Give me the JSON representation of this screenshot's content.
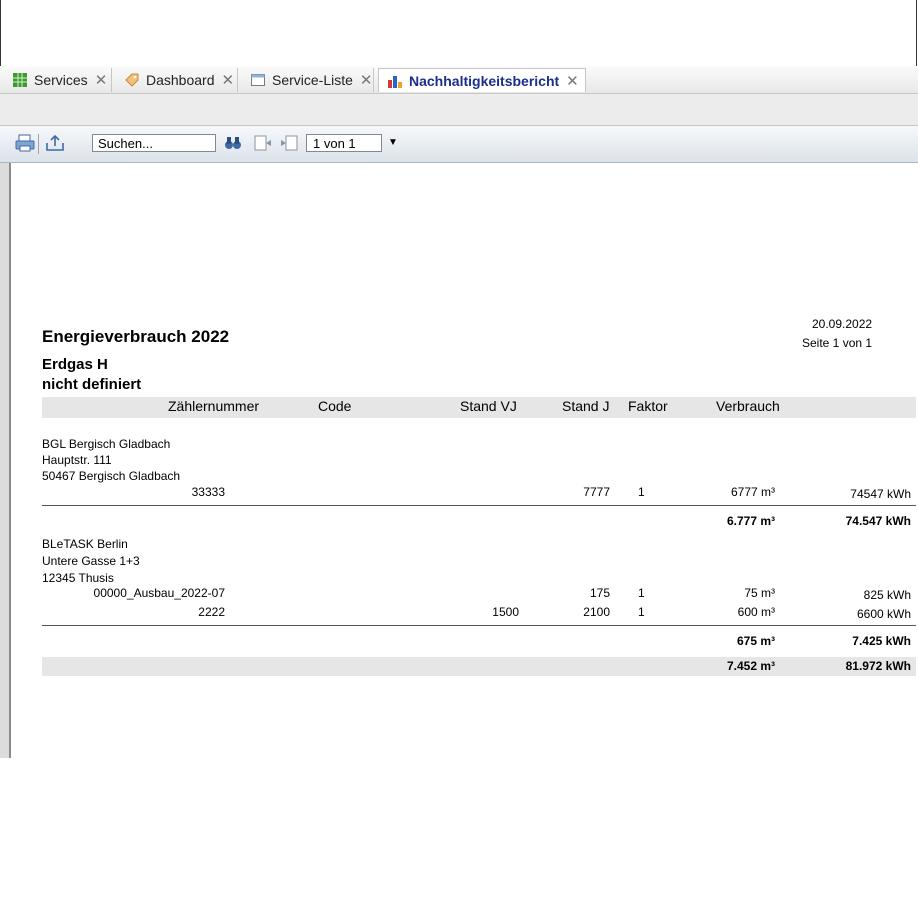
{
  "tabs": [
    {
      "label": "Services",
      "icon": "grid-icon"
    },
    {
      "label": "Dashboard",
      "icon": "tag-icon"
    },
    {
      "label": "Service-Liste",
      "icon": "window-icon"
    },
    {
      "label": "Nachhaltigkeitsbericht",
      "icon": "bar-chart-icon",
      "active": true
    }
  ],
  "toolbar": {
    "search_placeholder": "Suchen...",
    "page_value": "1 von 1"
  },
  "report": {
    "title": "Energieverbrauch 2022",
    "date": "20.09.2022",
    "page": "Seite 1 von 1",
    "fuel": "Erdgas H",
    "category": "nicht definiert",
    "columns": [
      "Zählernummer",
      "Code",
      "Stand VJ",
      "Stand J",
      "Faktor",
      "Verbrauch"
    ],
    "groups": [
      {
        "name": "BGL Bergisch Gladbach",
        "street": "Hauptstr. 111",
        "city": "50467 Bergisch Gladbach",
        "rows": [
          {
            "meter": "33333",
            "code": "",
            "stand_vj": "",
            "stand_j": "7777",
            "faktor": "1",
            "verbrauch": "6777 m³",
            "kwh": "74547 kWh"
          }
        ],
        "subtotal_m3": "6.777 m³",
        "subtotal_kwh": "74.547 kWh"
      },
      {
        "name": "BLeTASK Berlin",
        "street": "Untere Gasse 1+3",
        "city": "12345 Thusis",
        "rows": [
          {
            "meter": "00000_Ausbau_2022-07",
            "code": "",
            "stand_vj": "",
            "stand_j": "175",
            "faktor": "1",
            "verbrauch": "75 m³",
            "kwh": "825 kWh"
          },
          {
            "meter": "2222",
            "code": "",
            "stand_vj": "1500",
            "stand_j": "2100",
            "faktor": "1",
            "verbrauch": "600 m³",
            "kwh": "6600 kWh"
          }
        ],
        "subtotal_m3": "675 m³",
        "subtotal_kwh": "7.425 kWh"
      }
    ],
    "total_m3": "7.452 m³",
    "total_kwh": "81.972 kWh"
  }
}
